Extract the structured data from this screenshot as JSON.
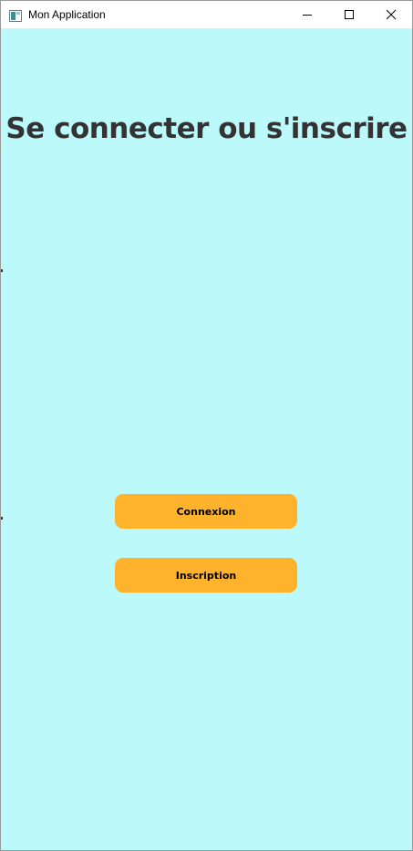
{
  "window": {
    "title": "Mon Application",
    "icon": "app-window-icon",
    "controls": [
      "minimize-icon",
      "maximize-icon",
      "close-icon"
    ]
  },
  "main": {
    "heading": "Se connecter ou s'inscrire",
    "login_label": "Connexion",
    "signup_label": "Inscription"
  },
  "colors": {
    "background": "#bbf9fb",
    "button": "#ffb22b",
    "heading_text": "#333333"
  }
}
